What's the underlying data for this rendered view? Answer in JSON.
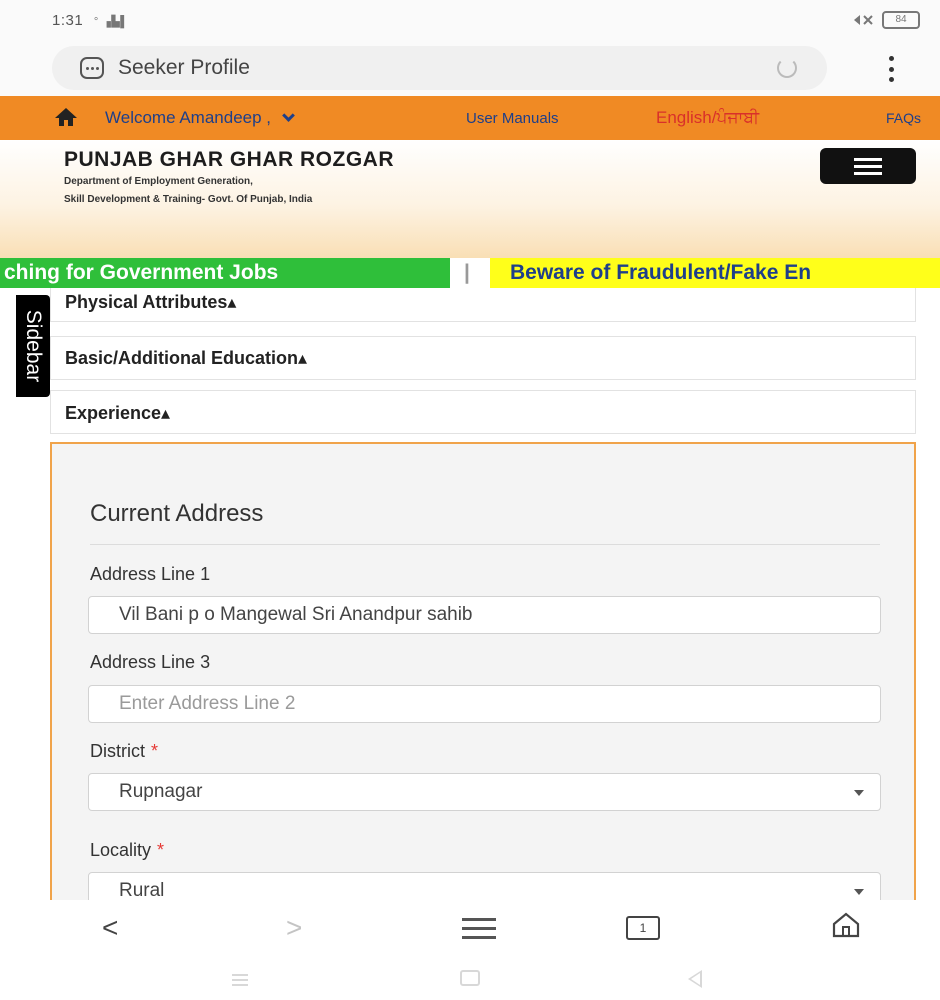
{
  "status_bar": {
    "time": "1:31",
    "signal": "° ▗▙▌",
    "battery": "84"
  },
  "browser": {
    "title": "Seeker Profile"
  },
  "topnav": {
    "welcome": "Welcome Amandeep ,",
    "user_manuals": "User Manuals",
    "language": "English/ਪੰਜਾਬੀ",
    "faqs": "FAQs"
  },
  "header": {
    "brand": "PUNJAB GHAR GHAR ROZGAR",
    "dept_line1": "Department of Employment Generation,",
    "dept_line2": "Skill Development & Training- Govt. Of Punjab, India"
  },
  "ticker": {
    "green_text": "ching for Government Jobs",
    "separator": "|",
    "yellow_text": "Beware of Fraudulent/Fake En"
  },
  "sidebar": {
    "label": "Sidebar"
  },
  "accordion": [
    {
      "label": "Physical Attributes▴"
    },
    {
      "label": "Basic/Additional Education▴"
    },
    {
      "label": "Experience▴"
    }
  ],
  "address": {
    "title": "Current Address",
    "line1_label": "Address Line 1",
    "line1_value": "Vil Bani p o Mangewal Sri Anandpur sahib",
    "line3_label": "Address Line 3",
    "line3_placeholder": "Enter Address Line 2",
    "district_label": "District",
    "district_value": "Rupnagar",
    "locality_label": "Locality",
    "locality_value": "Rural",
    "required_mark": "*"
  },
  "bottom_bar": {
    "back": "<",
    "forward": ">",
    "tabs_count": "1"
  },
  "colors": {
    "nav_orange": "#f08a24",
    "nav_link": "#1e3f8a",
    "ticker_green": "#2fbf3a",
    "ticker_yellow": "#ffff1a",
    "panel_border": "#f0a34a",
    "required": "#e53935"
  }
}
